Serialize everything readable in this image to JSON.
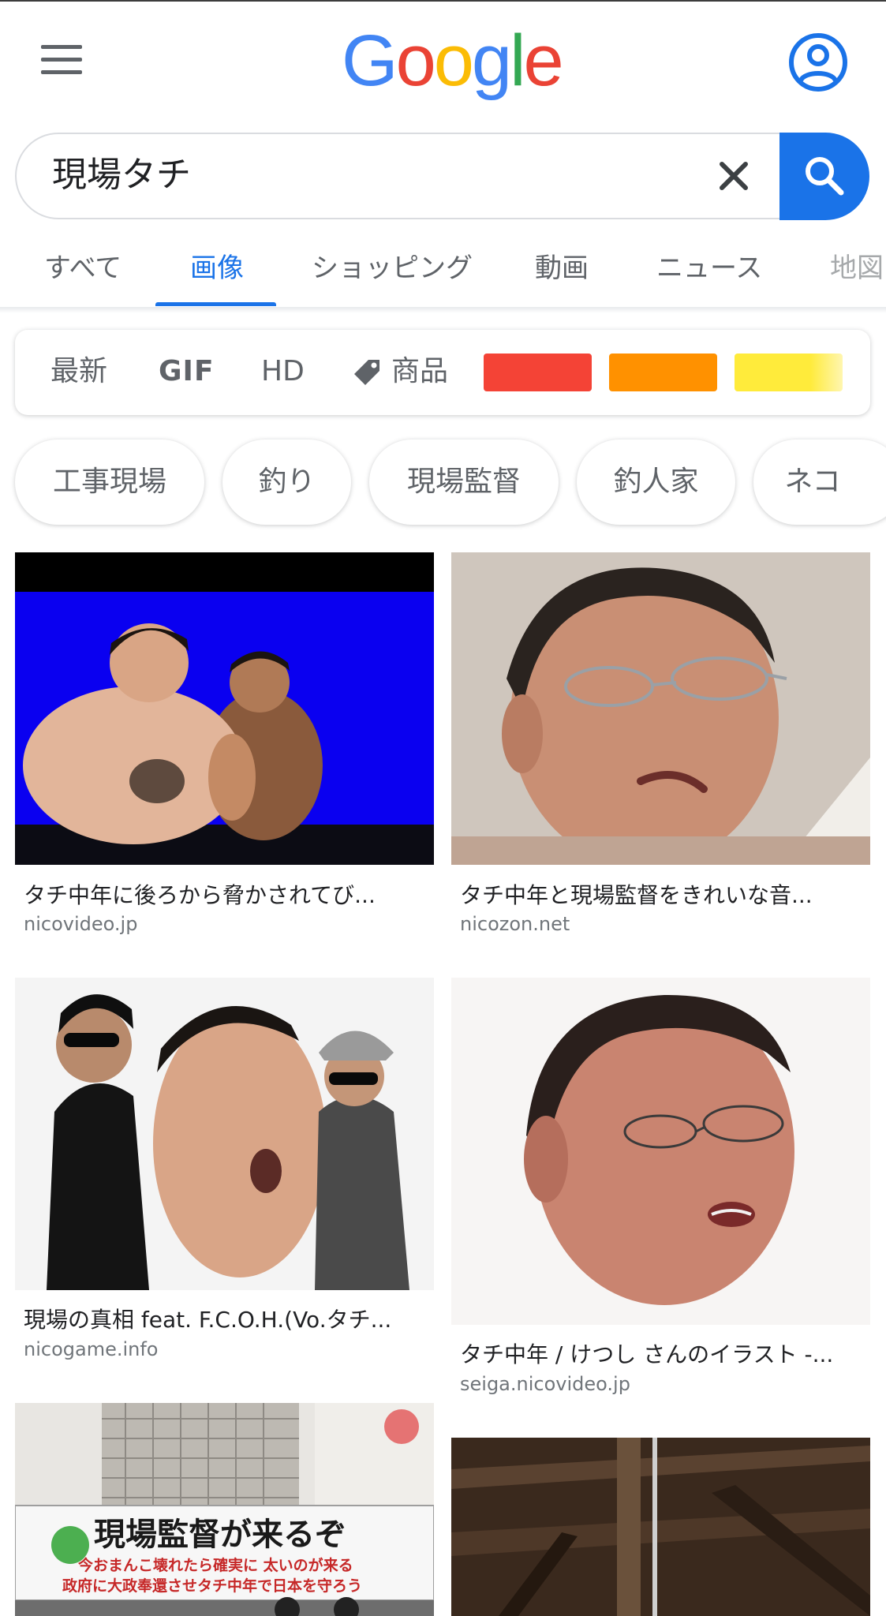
{
  "header": {
    "logo_letters": [
      {
        "ch": "G",
        "color": "#4285F4"
      },
      {
        "ch": "o",
        "color": "#EA4335"
      },
      {
        "ch": "o",
        "color": "#FBBC05"
      },
      {
        "ch": "g",
        "color": "#4285F4"
      },
      {
        "ch": "l",
        "color": "#34A853"
      },
      {
        "ch": "e",
        "color": "#EA4335"
      }
    ],
    "menu_icon": "hamburger-menu-icon",
    "account_icon": "account-circle-icon"
  },
  "search": {
    "query": "現場タチ",
    "clear_icon": "close-icon",
    "submit_icon": "search-icon"
  },
  "tabs": [
    {
      "label": "すべて",
      "active": false
    },
    {
      "label": "画像",
      "active": true
    },
    {
      "label": "ショッピング",
      "active": false
    },
    {
      "label": "動画",
      "active": false
    },
    {
      "label": "ニュース",
      "active": false
    },
    {
      "label": "地図",
      "active": false
    }
  ],
  "tools": {
    "recent": "最新",
    "gif": "GIF",
    "hd": "HD",
    "products": "商品",
    "products_icon": "tag-icon",
    "color_swatches": [
      "#f44336",
      "#ff9100",
      "#ffeb3b"
    ]
  },
  "chips": [
    "工事現場",
    "釣り",
    "現場監督",
    "釣人家",
    "ネコ"
  ],
  "results": [
    {
      "title": "タチ中年に後ろから脅かされてび...",
      "domain": "nicovideo.jp"
    },
    {
      "title": "タチ中年と現場監督をきれいな音...",
      "domain": "nicozon.net"
    },
    {
      "title": "現場の真相 feat. F.C.O.H.(Vo.タチ...",
      "domain": "nicogame.info"
    },
    {
      "title": "タチ中年 / けつし さんのイラスト -...",
      "domain": "seiga.nicovideo.jp"
    }
  ],
  "truck_banner": {
    "headline": "現場監督が来るぞ",
    "line1": "今おまんこ壊れたら確実に 太いのが来る",
    "line2": "政府に大政奉還させタチ中年で日本を守ろう"
  }
}
